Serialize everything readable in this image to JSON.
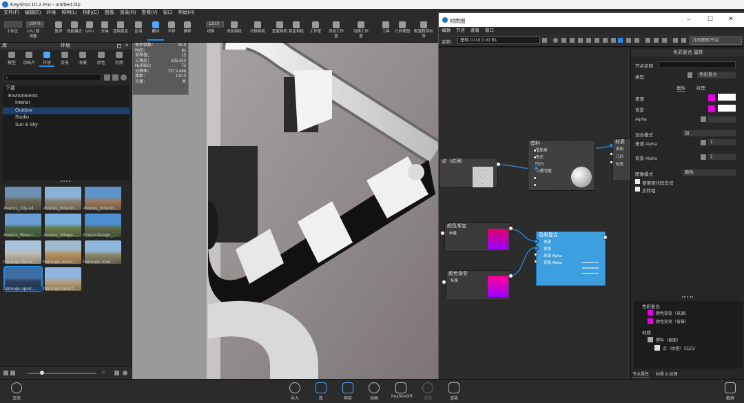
{
  "app": {
    "title": "KeyShot 10.2 Pro  -  untitled.bip"
  },
  "menu": [
    "文件(F)",
    "编辑(E)",
    "环境",
    "照明(L)",
    "相机(C)",
    "图像",
    "渲染(R)",
    "查看(V)",
    "窗口",
    "帮助(H)"
  ],
  "toolbar": {
    "box1": "",
    "box2": "100 %",
    "box3": "120.0",
    "items": [
      "工作区",
      "CPU 使用量",
      "暂停",
      "性能模式",
      "GPU",
      "去噪",
      "渲染锁定",
      "区域",
      "翻译",
      "平移",
      "推移",
      "视角",
      "添加相机",
      "切换相机",
      "重置相机",
      "锁定相机",
      "工作室",
      "添加工作室",
      "切换工作室",
      "工具",
      "几何视图",
      "配置程序向导"
    ]
  },
  "library": {
    "title": "库",
    "env_title": "环境",
    "tabs": [
      "模型",
      "动画片",
      "环境",
      "背景",
      "收藏",
      "颜色",
      "材质"
    ],
    "tree": [
      "下载",
      "Environments",
      "Interior",
      "Outdoor",
      "Studio",
      "Sun & Sky"
    ],
    "thumbs": [
      "Aversis_City-all...",
      "Aversis_Industri...",
      "Aversis_Industri...",
      "Aversis_River-r...",
      "Aversis_Village-...",
      "Dosch-Design_...",
      "hdrmaps-flume...",
      "hdrmaps-moun...",
      "hdrmaps-road-...",
      "hdrmaps-sport...",
      "hdrmaps-view-f..."
    ]
  },
  "hud": [
    [
      "每秒帧数：",
      "25.9"
    ],
    [
      "时间：",
      "8s"
    ],
    [
      "采样值：",
      "15"
    ],
    [
      "三角形：",
      "105,252"
    ],
    [
      "NURBS：",
      "72"
    ],
    [
      "分辨率：",
      "737 x 488"
    ],
    [
      "焦距：",
      "120.0"
    ],
    [
      "光量：",
      "关"
    ]
  ],
  "material_graph": {
    "title": "材质图",
    "menu": [
      "编辑",
      "节点",
      "查看",
      "窗口"
    ],
    "name_label": "名称:",
    "name_value": "塑料 0.0.0.0 #0 B1",
    "nodes": {
      "texture": "点（纹理）",
      "plastic": "塑料",
      "plastic_ports": [
        "漫反射",
        "高光",
        "凹凸",
        "不透明度",
        "."
      ],
      "gradient1": "颜色渐变",
      "gradient1_sub": "标量",
      "gradient2": "颜色渐变",
      "gradient2_sub": "标量",
      "blend": "色彩复合",
      "blend_ports": [
        "来源",
        "背景",
        "来源 Alpha",
        "背景 Alpha"
      ],
      "output": "材质",
      "output_ports": [
        "表面",
        "几何",
        "标签"
      ]
    },
    "btn_geom": "几何图形节点"
  },
  "properties": {
    "title": "色彩复合  属性",
    "node_name_label": "节点名称:",
    "type_label": "类型:",
    "type_value": "色彩复合",
    "tab_attr": "属性",
    "tab_texture": "纹理",
    "source": "来源",
    "background": "背景",
    "alpha": "Alpha",
    "blend_mode": "混合模式",
    "blend_mode_value": "加",
    "src_alpha": "来源 Alpha",
    "src_alpha_val": "1",
    "bg_alpha": "背景 Alpha",
    "bg_alpha_val": "1",
    "output_mode": "图像模式",
    "output_mode_value": "颜色",
    "cb1": "使用预代码剪切",
    "cb2": "反转相",
    "tree": [
      "色彩复合",
      "颜色渐变（来源）",
      "颜色渐变（背景）",
      "材质",
      "塑料（表面）",
      "点（纹理）（凹凸）"
    ],
    "tab_props": "节点属性",
    "tab_mat": "材质 & 纹理"
  },
  "bottom": {
    "cloud": "云库",
    "items": [
      "导入",
      "库",
      "项目",
      "动画",
      "KeyShotXR",
      "渲染",
      "渲染"
    ],
    "right": "截屏"
  },
  "colors": {
    "accent": "#1f8fe8",
    "magenta": "#e600e6",
    "node_blue": "#3d9fe0"
  }
}
